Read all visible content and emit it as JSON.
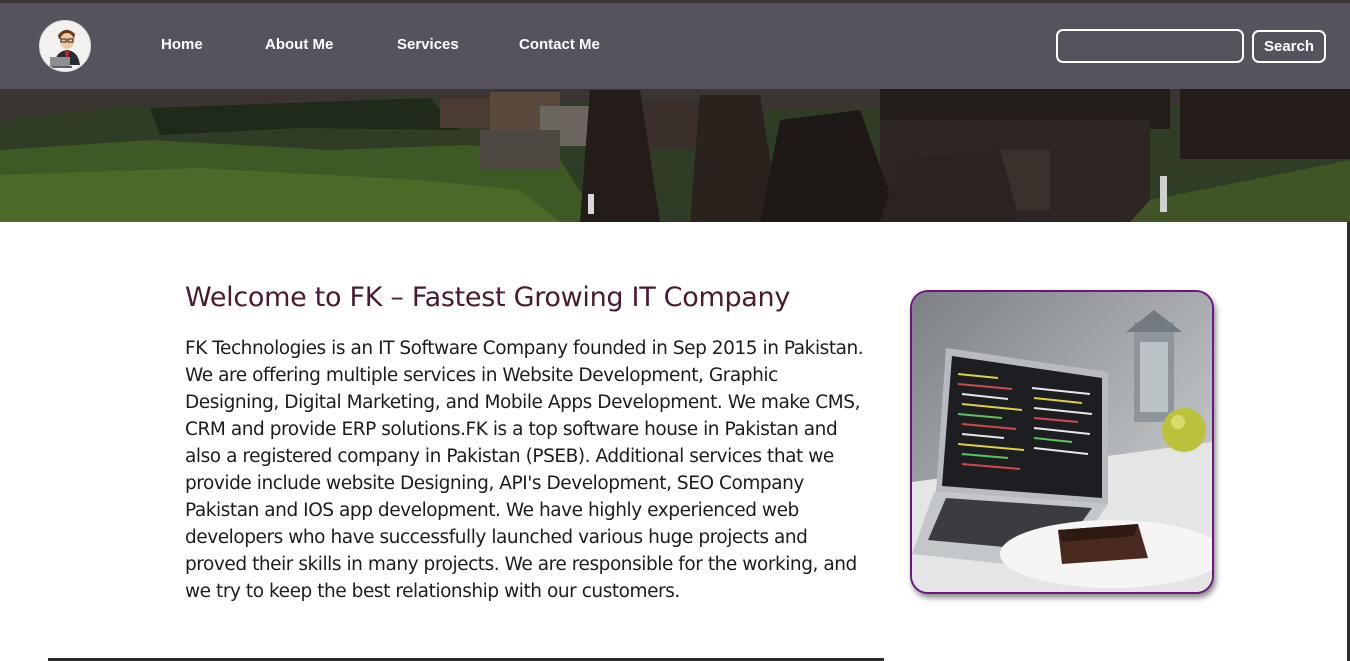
{
  "nav": {
    "items": [
      {
        "label": "Home"
      },
      {
        "label": "About Me"
      },
      {
        "label": "Services"
      },
      {
        "label": "Contact Me"
      }
    ]
  },
  "search": {
    "placeholder": "",
    "value": "",
    "button_label": "Search"
  },
  "welcome": {
    "title": "Welcome to FK – Fastest Growing IT Company",
    "body": "FK Technologies is an IT Software Company founded in Sep 2015 in Pakistan. We are offering multiple services in Website Development, Graphic Designing, Digital Marketing, and Mobile Apps Development. We make CMS, CRM and provide ERP solutions.FK is a top software house in Pakistan and also a registered company in Pakistan (PSEB). Additional services that we provide include website Designing, API's Development, SEO Company Pakistan and IOS app development. We have highly experienced web developers who have successfully launched various huge projects and proved their skills in many projects. We are responsible for the working, and we try to keep the best relationship with our customers."
  },
  "colors": {
    "navbar": "#585663",
    "title": "#4a1a32",
    "photo_border": "#6e1584"
  },
  "icons": {
    "logo": "developer-avatar-icon"
  }
}
